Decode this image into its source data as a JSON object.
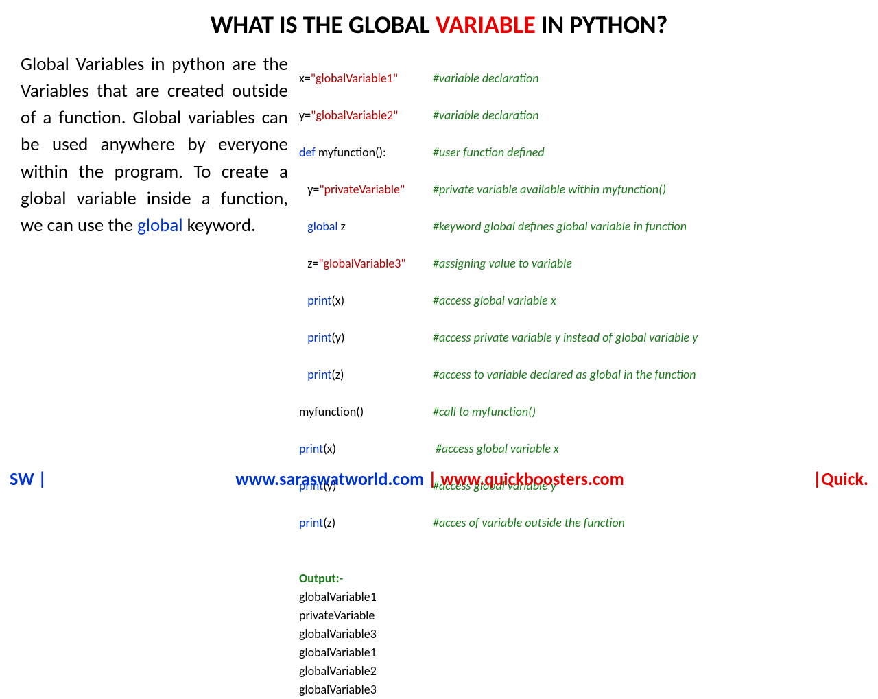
{
  "title": {
    "pre": "WHAT IS THE GLOBAL ",
    "highlight": "VARIABLE",
    "post": " IN PYTHON?"
  },
  "paragraph": {
    "p1": "Global Variables in python are the Variables that are created outside of a function. Global variables can be used anywhere by everyone within the program. To create a global variable inside a function, we can use the ",
    "kw": "global",
    "p2": " keyword."
  },
  "code": {
    "l1": {
      "a": "x",
      "b": "=",
      "c": "\"globalVariable1\"",
      "cm": "#variable declaration"
    },
    "l2": {
      "a": "y",
      "b": "=",
      "c": "\"globalVariable2\"",
      "cm": "#variable declaration"
    },
    "l3": {
      "a": "def ",
      "b": "myfunction",
      "c": "():",
      "cm": "#user function defined"
    },
    "l4": {
      "pad": "   ",
      "a": "y",
      "b": "=",
      "c": "\"privateVariable\"",
      "cm": "#private variable available within myfunction()"
    },
    "l5": {
      "pad": "   ",
      "a": "global ",
      "b": "z",
      "cm": "#keyword global defines global variable in function"
    },
    "l6": {
      "pad": "   ",
      "a": "z",
      "b": "=",
      "c": "\"globalVariable3\"",
      "cm": "#assigning value to variable"
    },
    "l7": {
      "pad": "   ",
      "a": "print",
      "b": "(",
      "c": "x",
      "d": ")",
      "cm": "#access global variable x"
    },
    "l8": {
      "pad": "   ",
      "a": "print",
      "b": "(",
      "c": "y",
      "d": ")",
      "cm": "#access private variable y instead of global variable y"
    },
    "l9": {
      "pad": "   ",
      "a": "print",
      "b": "(",
      "c": "z",
      "d": ")",
      "cm": "#access to variable declared as global in the function"
    },
    "l10": {
      "a": "myfunction",
      "b": "()",
      "cm": "#call to myfunction()"
    },
    "l11": {
      "a": "print",
      "b": "(",
      "c": "x",
      "d": ")",
      "cm": " #access global variable x"
    },
    "l12": {
      "a": "print",
      "b": "(",
      "c": "y",
      "d": ")",
      "cm": "#access global variable y"
    },
    "l13": {
      "a": "print",
      "b": "(",
      "c": "z",
      "d": ")",
      "cm": "#acces of variable outside the function"
    }
  },
  "output": {
    "header": "Output:-",
    "lines": [
      "globalVariable1",
      "privateVariable",
      "globalVariable3",
      "globalVariable1",
      "globalVariable2",
      "globalVariable3"
    ]
  },
  "footer": {
    "sw": "SW |",
    "site1": "www.saraswatworld.com",
    "bar": " | ",
    "site2": "www.quickboosters.com",
    "right": "|Quick."
  }
}
